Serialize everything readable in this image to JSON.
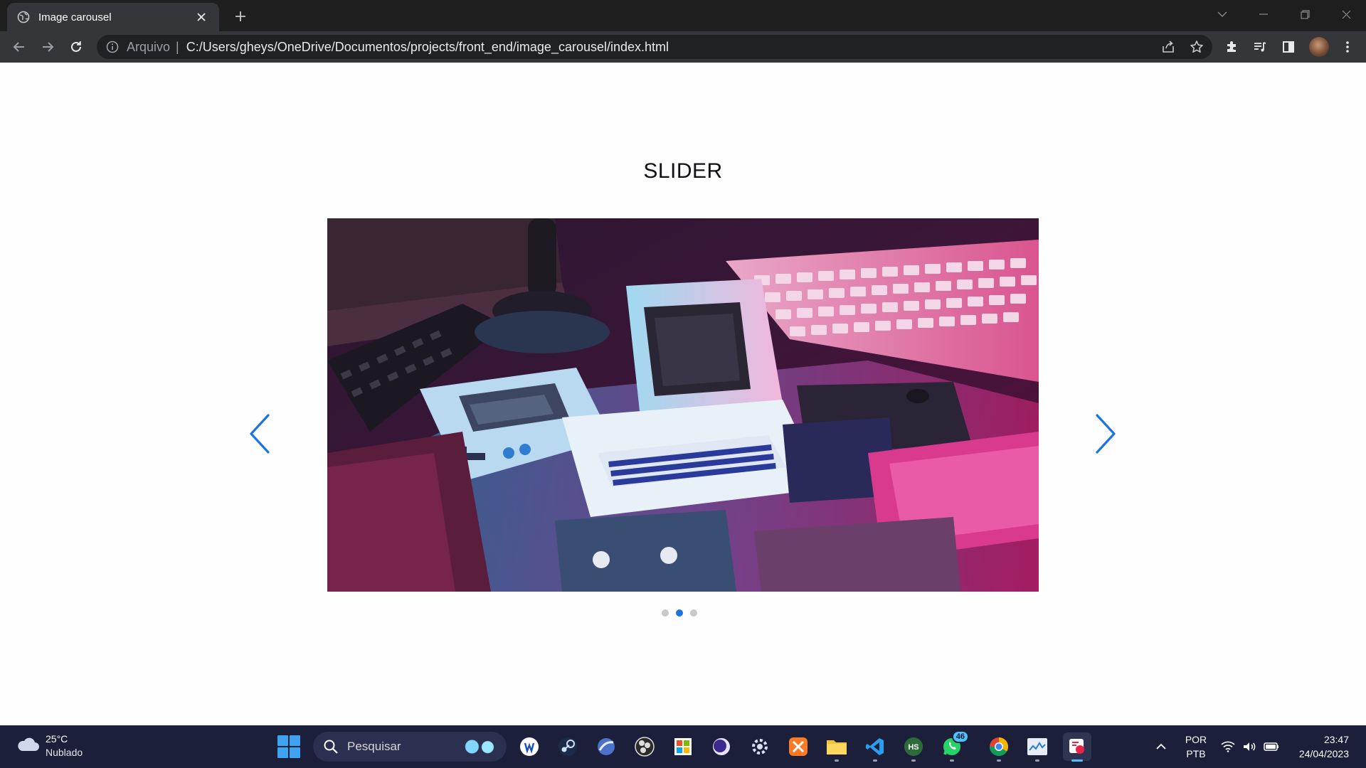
{
  "browser": {
    "tab_title": "Image carousel",
    "address_scheme": "Arquivo",
    "address_separator": "|",
    "address_url": "C:/Users/gheys/OneDrive/Documentos/projects/front_end/image_carousel/index.html"
  },
  "page": {
    "title": "SLIDER",
    "carousel": {
      "slide_count": 3,
      "active_slide": 2,
      "image_subject": "retro computers and Game Boy under neon pink and blue light"
    }
  },
  "taskbar": {
    "weather_temp": "25°C",
    "weather_desc": "Nublado",
    "search_placeholder": "Pesquisar",
    "whatsapp_badge": "46",
    "lang_primary": "POR",
    "lang_secondary": "PTB",
    "time": "23:47",
    "date": "24/04/2023"
  },
  "colors": {
    "accent": "#1b75e0",
    "tab_title": "#ffffff",
    "chrome_dark": "#1e1e1f",
    "taskbar": "#1b1f3a"
  },
  "icons": {
    "tab_favicon": "globe-icon",
    "prev": "chevron-left-icon",
    "next": "chevron-right-icon"
  }
}
